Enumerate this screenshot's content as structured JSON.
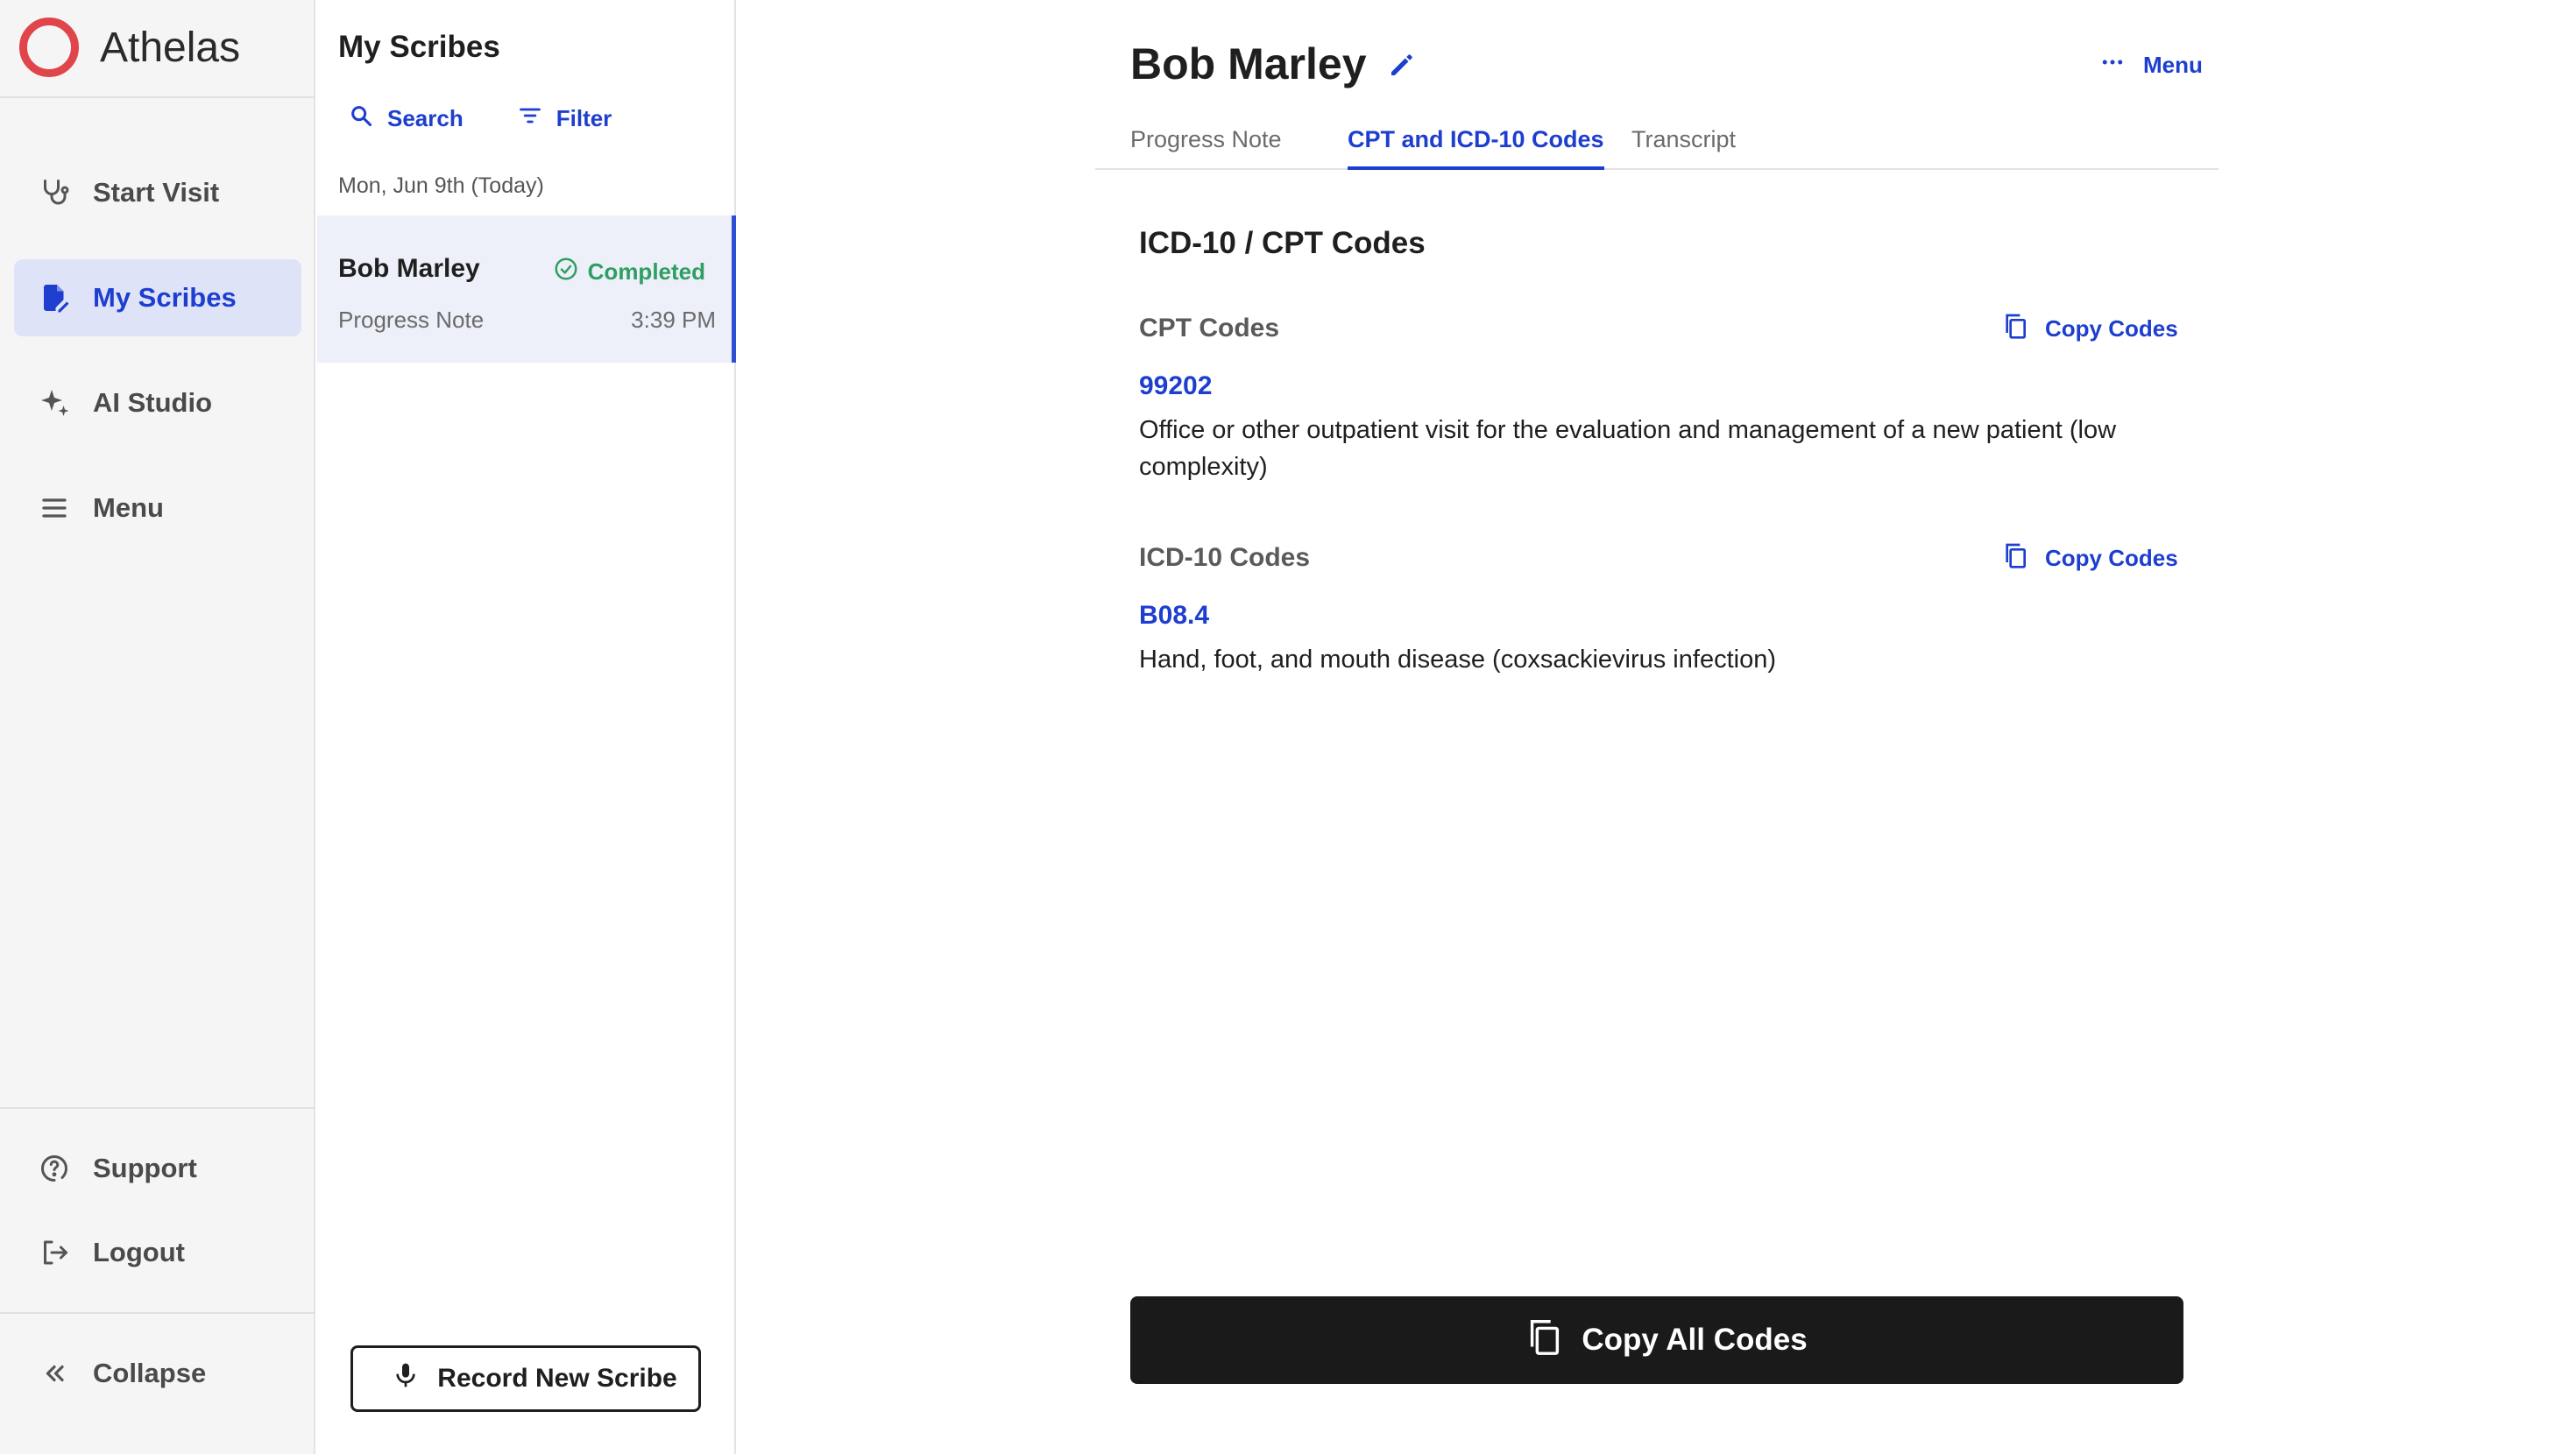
{
  "brand": {
    "name": "Athelas",
    "logo_color": "#e0454b"
  },
  "sidebar": {
    "items": [
      {
        "label": "Start Visit",
        "icon": "stethoscope-icon"
      },
      {
        "label": "My Scribes",
        "icon": "document-edit-icon",
        "active": true
      },
      {
        "label": "AI Studio",
        "icon": "sparkle-icon"
      },
      {
        "label": "Menu",
        "icon": "hamburger-icon"
      }
    ],
    "bottom": [
      {
        "label": "Support",
        "icon": "help-circle-icon"
      },
      {
        "label": "Logout",
        "icon": "logout-icon"
      }
    ],
    "collapse_label": "Collapse"
  },
  "scribes": {
    "title": "My Scribes",
    "search_label": "Search",
    "filter_label": "Filter",
    "date_header": "Mon, Jun 9th (Today)",
    "rows": [
      {
        "name": "Bob Marley",
        "status": "Completed",
        "type": "Progress Note",
        "time": "3:39 PM"
      }
    ],
    "record_button": "Record New Scribe"
  },
  "main": {
    "patient_name": "Bob Marley",
    "menu_label": "Menu",
    "tabs": [
      {
        "label": "Progress Note"
      },
      {
        "label": "CPT and ICD-10 Codes",
        "active": true
      },
      {
        "label": "Transcript"
      }
    ],
    "section_title": "ICD-10 / CPT Codes",
    "cpt": {
      "label": "CPT Codes",
      "copy_label": "Copy Codes",
      "code": "99202",
      "description": "Office or other outpatient visit for the evaluation and management of a new patient (low complexity)"
    },
    "icd": {
      "label": "ICD-10 Codes",
      "copy_label": "Copy Codes",
      "code": "B08.4",
      "description": "Hand, foot, and mouth disease (coxsackievirus infection)"
    },
    "copy_all_label": "Copy All Codes"
  },
  "colors": {
    "accent": "#1d3ecf",
    "active_nav_bg": "#dfe3f8",
    "status_green": "#2f9e62",
    "primary_button": "#1a1a1a"
  }
}
